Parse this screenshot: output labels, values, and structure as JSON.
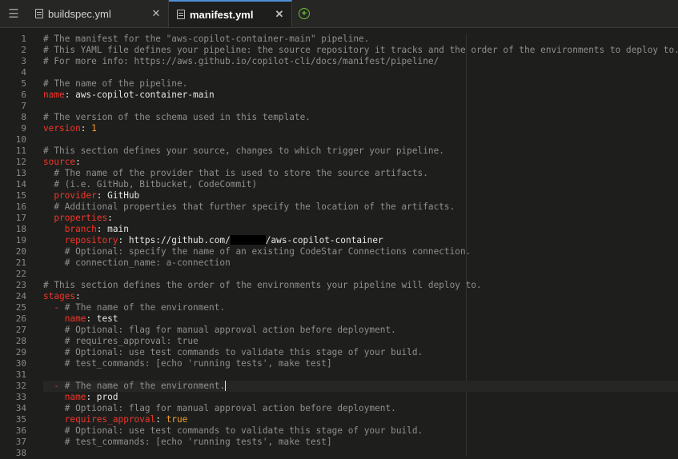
{
  "tabs": [
    {
      "label": "buildspec.yml",
      "active": false
    },
    {
      "label": "manifest.yml",
      "active": true
    }
  ],
  "lines": [
    {
      "n": "1",
      "parts": [
        {
          "t": "# The manifest for the \"aws-copilot-container-main\" pipeline.",
          "c": "c"
        }
      ]
    },
    {
      "n": "2",
      "parts": [
        {
          "t": "# This YAML file defines your pipeline: the source repository it tracks and the order of the environments to deploy to.",
          "c": "c"
        }
      ]
    },
    {
      "n": "3",
      "parts": [
        {
          "t": "# For more info: https://aws.github.io/copilot-cli/docs/manifest/pipeline/",
          "c": "c"
        }
      ]
    },
    {
      "n": "4",
      "parts": []
    },
    {
      "n": "5",
      "parts": [
        {
          "t": "# The name of the pipeline.",
          "c": "c"
        }
      ]
    },
    {
      "n": "6",
      "parts": [
        {
          "t": "name",
          "c": "k"
        },
        {
          "t": ": aws-copilot-container-main",
          "c": "s"
        }
      ]
    },
    {
      "n": "7",
      "parts": []
    },
    {
      "n": "8",
      "parts": [
        {
          "t": "# The version of the schema used in this template.",
          "c": "c"
        }
      ]
    },
    {
      "n": "9",
      "parts": [
        {
          "t": "version",
          "c": "k"
        },
        {
          "t": ": ",
          "c": "s"
        },
        {
          "t": "1",
          "c": "n"
        }
      ]
    },
    {
      "n": "10",
      "parts": []
    },
    {
      "n": "11",
      "parts": [
        {
          "t": "# This section defines your source, changes to which trigger your pipeline.",
          "c": "c"
        }
      ]
    },
    {
      "n": "12",
      "parts": [
        {
          "t": "source",
          "c": "k"
        },
        {
          "t": ":",
          "c": "s"
        }
      ]
    },
    {
      "n": "13",
      "parts": [
        {
          "t": "  # The name of the provider that is used to store the source artifacts.",
          "c": "c"
        }
      ]
    },
    {
      "n": "14",
      "parts": [
        {
          "t": "  # (i.e. GitHub, Bitbucket, CodeCommit)",
          "c": "c"
        }
      ]
    },
    {
      "n": "15",
      "parts": [
        {
          "t": "  ",
          "c": "s"
        },
        {
          "t": "provider",
          "c": "k"
        },
        {
          "t": ": GitHub",
          "c": "s"
        }
      ]
    },
    {
      "n": "16",
      "parts": [
        {
          "t": "  # Additional properties that further specify the location of the artifacts.",
          "c": "c"
        }
      ]
    },
    {
      "n": "17",
      "parts": [
        {
          "t": "  ",
          "c": "s"
        },
        {
          "t": "properties",
          "c": "k"
        },
        {
          "t": ":",
          "c": "s"
        }
      ]
    },
    {
      "n": "18",
      "parts": [
        {
          "t": "    ",
          "c": "s"
        },
        {
          "t": "branch",
          "c": "k"
        },
        {
          "t": ": main",
          "c": "s"
        }
      ]
    },
    {
      "n": "19",
      "parts": [
        {
          "t": "    ",
          "c": "s"
        },
        {
          "t": "repository",
          "c": "k"
        },
        {
          "t": ": https://github.com/",
          "c": "s"
        },
        {
          "t": "",
          "c": "redact"
        },
        {
          "t": "/aws-copilot-container",
          "c": "s"
        }
      ]
    },
    {
      "n": "20",
      "parts": [
        {
          "t": "    # Optional: specify the name of an existing CodeStar Connections connection.",
          "c": "c"
        }
      ]
    },
    {
      "n": "21",
      "parts": [
        {
          "t": "    # connection_name: a-connection",
          "c": "c"
        }
      ]
    },
    {
      "n": "22",
      "parts": []
    },
    {
      "n": "23",
      "parts": [
        {
          "t": "# This section defines the order of the environments your pipeline will deploy to.",
          "c": "c"
        }
      ]
    },
    {
      "n": "24",
      "parts": [
        {
          "t": "stages",
          "c": "k"
        },
        {
          "t": ":",
          "c": "s"
        }
      ]
    },
    {
      "n": "25",
      "parts": [
        {
          "t": "  ",
          "c": "s"
        },
        {
          "t": "-",
          "c": "k"
        },
        {
          "t": " # The name of the environment.",
          "c": "c"
        }
      ]
    },
    {
      "n": "26",
      "parts": [
        {
          "t": "    ",
          "c": "s"
        },
        {
          "t": "name",
          "c": "k"
        },
        {
          "t": ": test",
          "c": "s"
        }
      ]
    },
    {
      "n": "27",
      "parts": [
        {
          "t": "    # Optional: flag for manual approval action before deployment.",
          "c": "c"
        }
      ]
    },
    {
      "n": "28",
      "parts": [
        {
          "t": "    # requires_approval: true",
          "c": "c"
        }
      ]
    },
    {
      "n": "29",
      "parts": [
        {
          "t": "    # Optional: use test commands to validate this stage of your build.",
          "c": "c"
        }
      ]
    },
    {
      "n": "30",
      "parts": [
        {
          "t": "    # test_commands: [echo 'running tests', make test]",
          "c": "c"
        }
      ]
    },
    {
      "n": "31",
      "parts": []
    },
    {
      "n": "32",
      "parts": [
        {
          "t": "  ",
          "c": "s"
        },
        {
          "t": "-",
          "c": "k"
        },
        {
          "t": " # The name of the environment.",
          "c": "c"
        },
        {
          "t": "",
          "c": "caret"
        }
      ],
      "current": true
    },
    {
      "n": "33",
      "parts": [
        {
          "t": "    ",
          "c": "s"
        },
        {
          "t": "name",
          "c": "k"
        },
        {
          "t": ": prod",
          "c": "s"
        }
      ]
    },
    {
      "n": "34",
      "parts": [
        {
          "t": "    # Optional: flag for manual approval action before deployment.",
          "c": "c"
        }
      ]
    },
    {
      "n": "35",
      "parts": [
        {
          "t": "    ",
          "c": "s"
        },
        {
          "t": "requires_approval",
          "c": "k"
        },
        {
          "t": ": ",
          "c": "s"
        },
        {
          "t": "true",
          "c": "n"
        }
      ]
    },
    {
      "n": "36",
      "parts": [
        {
          "t": "    # Optional: use test commands to validate this stage of your build.",
          "c": "c"
        }
      ]
    },
    {
      "n": "37",
      "parts": [
        {
          "t": "    # test_commands: [echo 'running tests', make test]",
          "c": "c"
        }
      ]
    },
    {
      "n": "38",
      "parts": []
    }
  ],
  "icons": {
    "menu": "☰",
    "close": "✕",
    "add": "+"
  },
  "colors": {
    "background": "#1e1f1c",
    "comment": "#8f8f8f",
    "key": "#f2352b",
    "number": "#f29d2b",
    "add_icon": "#6fbf3a"
  }
}
